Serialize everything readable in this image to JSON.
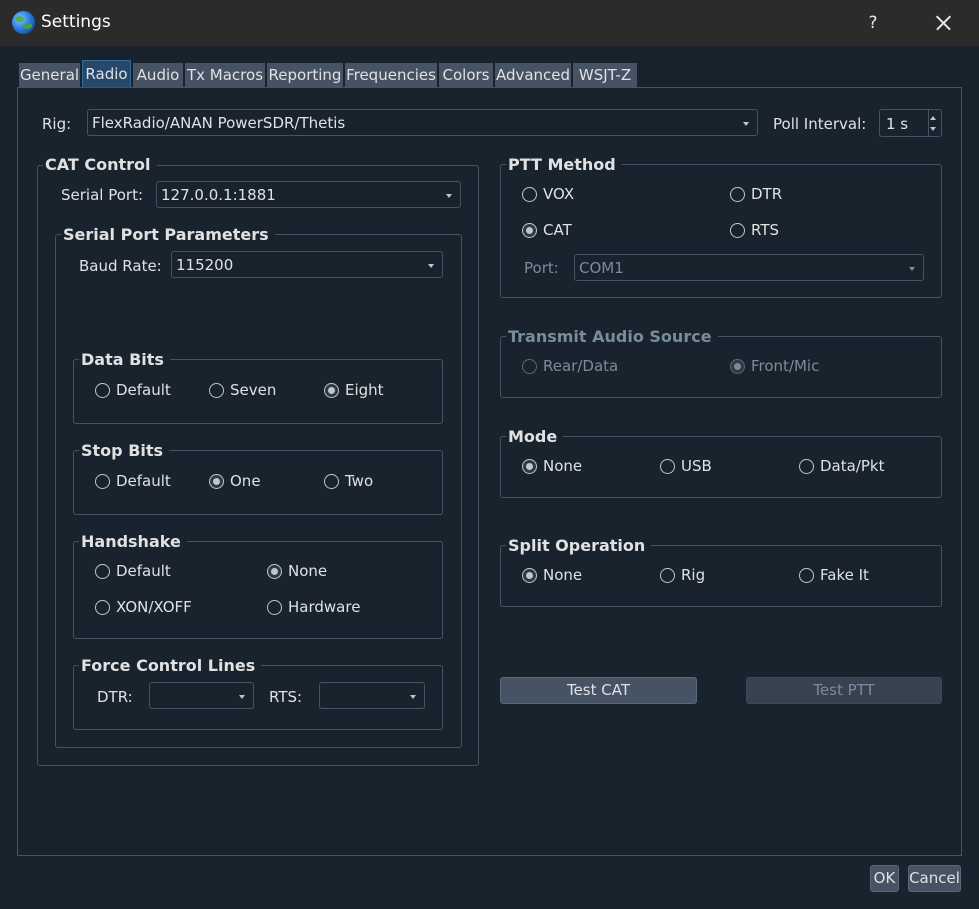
{
  "window": {
    "title": "Settings",
    "help": "?"
  },
  "tabs": [
    "General",
    "Radio",
    "Audio",
    "Tx Macros",
    "Reporting",
    "Frequencies",
    "Colors",
    "Advanced",
    "WSJT-Z"
  ],
  "rig": {
    "label": "Rig:",
    "value": "FlexRadio/ANAN PowerSDR/Thetis"
  },
  "poll": {
    "label": "Poll Interval:",
    "value": "1 s"
  },
  "cat": {
    "title": "CAT Control",
    "serial_label": "Serial Port:",
    "serial_value": "127.0.0.1:1881",
    "params_title": "Serial Port Parameters",
    "baud_label": "Baud Rate:",
    "baud_value": "115200"
  },
  "data_bits": {
    "title": "Data Bits",
    "options": [
      "Default",
      "Seven",
      "Eight"
    ],
    "selected": "Eight"
  },
  "stop_bits": {
    "title": "Stop Bits",
    "options": [
      "Default",
      "One",
      "Two"
    ],
    "selected": "One"
  },
  "handshake": {
    "title": "Handshake",
    "options": [
      "Default",
      "None",
      "XON/XOFF",
      "Hardware"
    ],
    "selected": "None"
  },
  "force_lines": {
    "title": "Force Control Lines",
    "dtr_label": "DTR:",
    "rts_label": "RTS:",
    "dtr_value": "",
    "rts_value": ""
  },
  "ptt": {
    "title": "PTT Method",
    "options": [
      "VOX",
      "DTR",
      "CAT",
      "RTS"
    ],
    "selected": "CAT",
    "port_label": "Port:",
    "port_value": "COM1"
  },
  "tx_audio": {
    "title": "Transmit Audio Source",
    "options": [
      "Rear/Data",
      "Front/Mic"
    ],
    "selected": "Front/Mic"
  },
  "mode": {
    "title": "Mode",
    "options": [
      "None",
      "USB",
      "Data/Pkt"
    ],
    "selected": "None"
  },
  "split": {
    "title": "Split Operation",
    "options": [
      "None",
      "Rig",
      "Fake It"
    ],
    "selected": "None"
  },
  "buttons": {
    "test_cat": "Test CAT",
    "test_ptt": "Test PTT",
    "ok": "OK",
    "cancel": "Cancel"
  }
}
